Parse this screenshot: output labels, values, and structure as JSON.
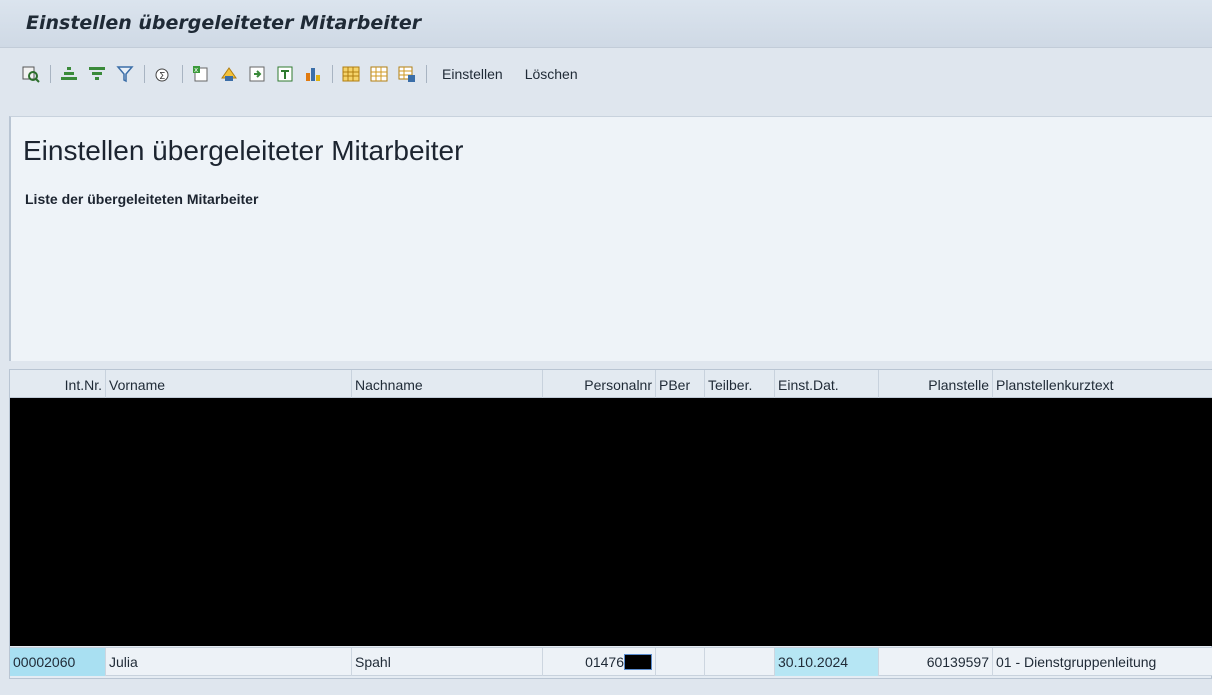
{
  "window": {
    "title": "Einstellen übergeleiteter Mitarbeiter"
  },
  "toolbar": {
    "icons": [
      "details-icon",
      "sort-ascending-icon",
      "sort-descending-icon",
      "filter-icon",
      "total-icon",
      "export-icon",
      "print-preview-icon",
      "layout-icon",
      "graphics-icon",
      "chart-icon",
      "change-layout-icon",
      "select-layout-icon",
      "save-layout-icon"
    ],
    "einstellen_label": "Einstellen",
    "loeschen_label": "Löschen"
  },
  "header": {
    "title": "Einstellen übergeleiteter Mitarbeiter",
    "subtitle": "Liste der übergeleiteten Mitarbeiter"
  },
  "table": {
    "columns": [
      "Int.Nr.",
      "Vorname",
      "Nachname",
      "Personalnr",
      "PBer",
      "Teilber.",
      "Einst.Dat.",
      "Planstelle",
      "Planstellenkurztext"
    ],
    "rows": [
      {
        "int_nr": "00002060",
        "vorname": "Julia",
        "nachname": "Spahl",
        "personalnr": "01476",
        "pber": "",
        "teilber": "",
        "einst_dat": "30.10.2024",
        "planstelle": "60139597",
        "planstellenkurztext": "01 - Dienstgruppenleitung"
      }
    ]
  },
  "colors": {
    "accent_key": "#a9e0f2",
    "accent_date": "#b6e6f4",
    "redaction": "#000000"
  }
}
